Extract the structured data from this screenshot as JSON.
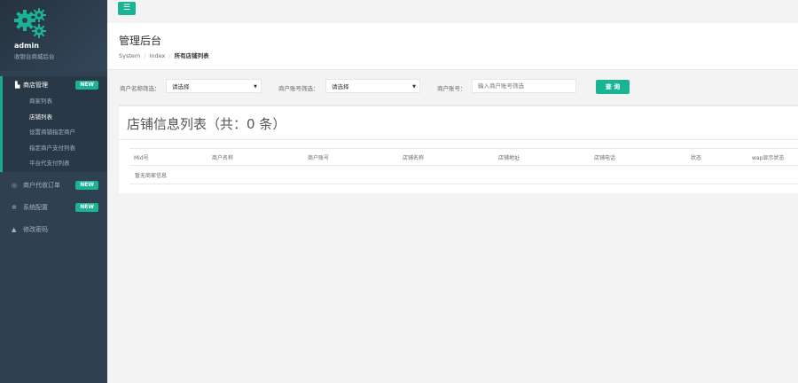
{
  "sidebar": {
    "user_name": "admin",
    "user_role": "收银台商城后台",
    "items": [
      {
        "label": "商店管理",
        "badge": "NEW"
      },
      {
        "label": "商户代收订单",
        "badge": "NEW"
      },
      {
        "label": "系统配置",
        "badge": "NEW"
      },
      {
        "label": "修改密码"
      }
    ],
    "submenu": [
      "商家列表",
      "店铺列表",
      "设置商铺指定商户",
      "指定商户支付列表",
      "平台代支付列表"
    ]
  },
  "topbar": {
    "menu_icon": "☰"
  },
  "heading": {
    "title": "管理后台",
    "breadcrumb": [
      "System",
      "Index",
      "所有店铺列表"
    ]
  },
  "filter": {
    "merchant_name_label": "商户名称筛选：",
    "merchant_name_value": "请选择",
    "merchant_account_label": "商户账号筛选：",
    "merchant_account_value": "请选择",
    "account_label": "商户账号：",
    "account_placeholder": "输入商户账号筛选",
    "query_button": "查 询"
  },
  "card": {
    "title": "店铺信息列表（共：0 条）",
    "columns": [
      "Mid号",
      "商户名称",
      "商户账号",
      "店铺名称",
      "店铺地址",
      "店铺电话",
      "状态",
      "wap显示状态"
    ],
    "empty_text": "暂无商家信息"
  },
  "colors": {
    "accent": "#1ab394",
    "sidebar": "#2f4050"
  }
}
